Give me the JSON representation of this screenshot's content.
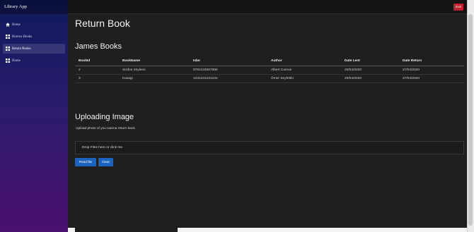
{
  "app": {
    "brand": "Library App"
  },
  "sidebar": {
    "items": [
      {
        "label": "Home",
        "icon": "home-icon"
      },
      {
        "label": "Borrow Books",
        "icon": "grid-icon"
      },
      {
        "label": "Return Books",
        "icon": "grid-icon",
        "active": true
      },
      {
        "label": "Home",
        "icon": "grid-icon"
      }
    ]
  },
  "topbar": {
    "exit_label": "Exit",
    "exit_color": "#c2202c"
  },
  "main": {
    "title": "Return Book",
    "books_section_title": "James Books",
    "table": {
      "headers": [
        "BookId",
        "BookName",
        "Isbn",
        "Author",
        "Date Lent",
        "Date Return"
      ],
      "rows": [
        [
          "2",
          "Sisifos Söylemi",
          "9781234567890",
          "Albert Camus",
          "20/04/2020",
          "27/04/2020"
        ],
        [
          "3",
          "Kasagi",
          "1231231231231",
          "Ömer Seyfettin",
          "20/04/2020",
          "27/04/2020"
        ]
      ]
    },
    "upload": {
      "title": "Uploading Image",
      "description": "Upload photo of you wanna return back.",
      "dropzone_text": "Drop Files here or click me",
      "read_button": "Read file",
      "clear_button": "Clear"
    }
  },
  "colors": {
    "accent": "#1a64c0",
    "danger": "#c2202c",
    "background": "#1f1f1f"
  }
}
